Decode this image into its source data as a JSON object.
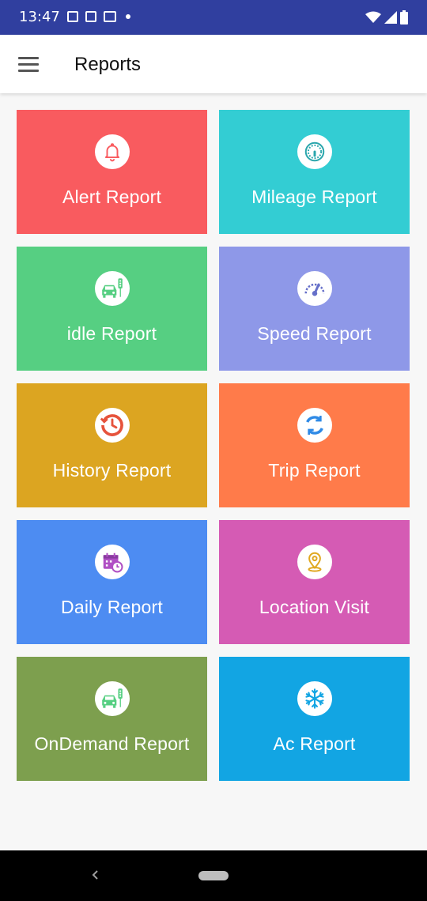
{
  "status_bar": {
    "time": "13:47",
    "icons": [
      "message-icon",
      "news-icon",
      "gb-icon",
      "dot-icon",
      "wifi-icon",
      "signal-icon",
      "battery-icon"
    ]
  },
  "app_bar": {
    "title": "Reports",
    "menu_icon": "hamburger-menu-icon"
  },
  "tiles": [
    {
      "label": "Alert Report",
      "icon": "bell-icon",
      "color": "#f95b5f",
      "icon_color": "#f95b5f"
    },
    {
      "label": "Mileage Report",
      "icon": "speedometer-icon",
      "color": "#33cdd3",
      "icon_color": "#2aa6ac"
    },
    {
      "label": "idle Report",
      "icon": "car-signal-icon",
      "color": "#56cf82",
      "icon_color": "#56cf82"
    },
    {
      "label": "Speed Report",
      "icon": "speed-gauge-icon",
      "color": "#8e98e8",
      "icon_color": "#6670c9"
    },
    {
      "label": "History Report",
      "icon": "history-clock-icon",
      "color": "#dca521",
      "icon_color": "#e6533c"
    },
    {
      "label": "Trip Report",
      "icon": "refresh-cycle-icon",
      "color": "#ff7b4a",
      "icon_color": "#2f8ae6"
    },
    {
      "label": "Daily Report",
      "icon": "calendar-clock-icon",
      "color": "#4d8cf2",
      "icon_color": "#b04fc4"
    },
    {
      "label": "Location Visit",
      "icon": "location-pin-icon",
      "color": "#d55bb4",
      "icon_color": "#e0a820"
    },
    {
      "label": "OnDemand Report",
      "icon": "car-signal-icon",
      "color": "#7d9f4e",
      "icon_color": "#56cf82"
    },
    {
      "label": "Ac Report",
      "icon": "snowflake-icon",
      "color": "#12a5e3",
      "icon_color": "#12a5e3"
    }
  ],
  "nav_bar": {
    "back_icon": "back-chevron-icon",
    "home_icon": "home-pill-icon"
  }
}
